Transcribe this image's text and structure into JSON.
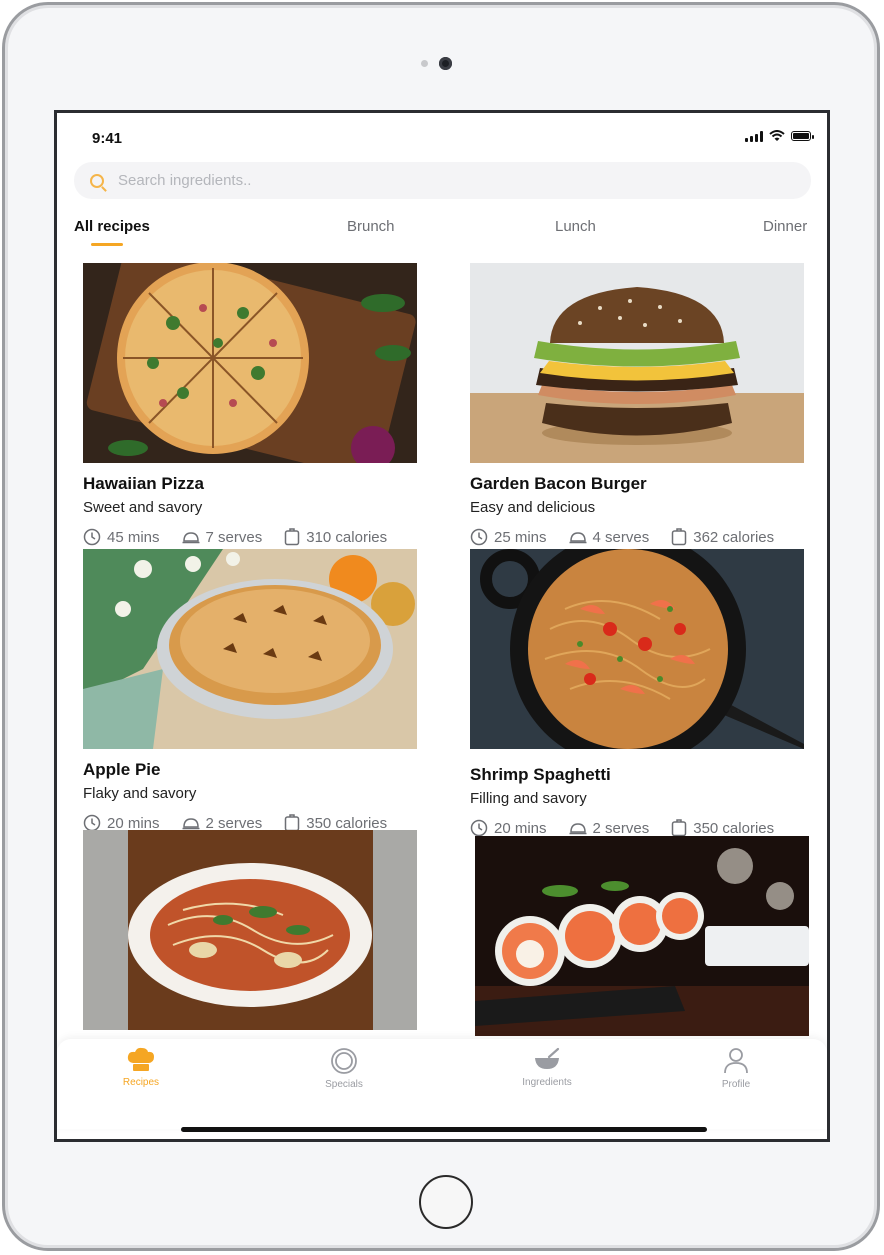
{
  "status": {
    "time": "9:41"
  },
  "search": {
    "placeholder": "Search ingredients.."
  },
  "tabs": [
    {
      "label": "All recipes",
      "active": true
    },
    {
      "label": "Brunch"
    },
    {
      "label": "Lunch"
    },
    {
      "label": "Dinner"
    }
  ],
  "recipes": [
    {
      "title": "Hawaiian Pizza",
      "subtitle": "Sweet and savory",
      "time": "45 mins",
      "serves": "7 serves",
      "calories": "310 calories",
      "image": "pizza-photo"
    },
    {
      "title": "Garden Bacon Burger",
      "subtitle": "Easy and delicious",
      "time": "25 mins",
      "serves": "4 serves",
      "calories": "362 calories",
      "image": "burger-photo"
    },
    {
      "title": "Apple Pie",
      "subtitle": "Flaky and savory",
      "time": "20 mins",
      "serves": "2 serves",
      "calories": "350 calories",
      "image": "apple-pie-photo"
    },
    {
      "title": "Shrimp Spaghetti",
      "subtitle": "Filling and savory",
      "time": "20 mins",
      "serves": "2 serves",
      "calories": "350 calories",
      "image": "shrimp-spaghetti-photo"
    },
    {
      "image": "noodle-soup-photo"
    },
    {
      "image": "sushi-photo"
    }
  ],
  "nav": [
    {
      "label": "Recipes",
      "icon": "chef-hat-icon",
      "active": true
    },
    {
      "label": "Specials",
      "icon": "plate-icon"
    },
    {
      "label": "Ingredients",
      "icon": "bowl-icon"
    },
    {
      "label": "Profile",
      "icon": "user-icon"
    }
  ],
  "colors": {
    "accent": "#f5a623",
    "muted": "#6d6f74",
    "search_bg": "#f4f4f6"
  }
}
